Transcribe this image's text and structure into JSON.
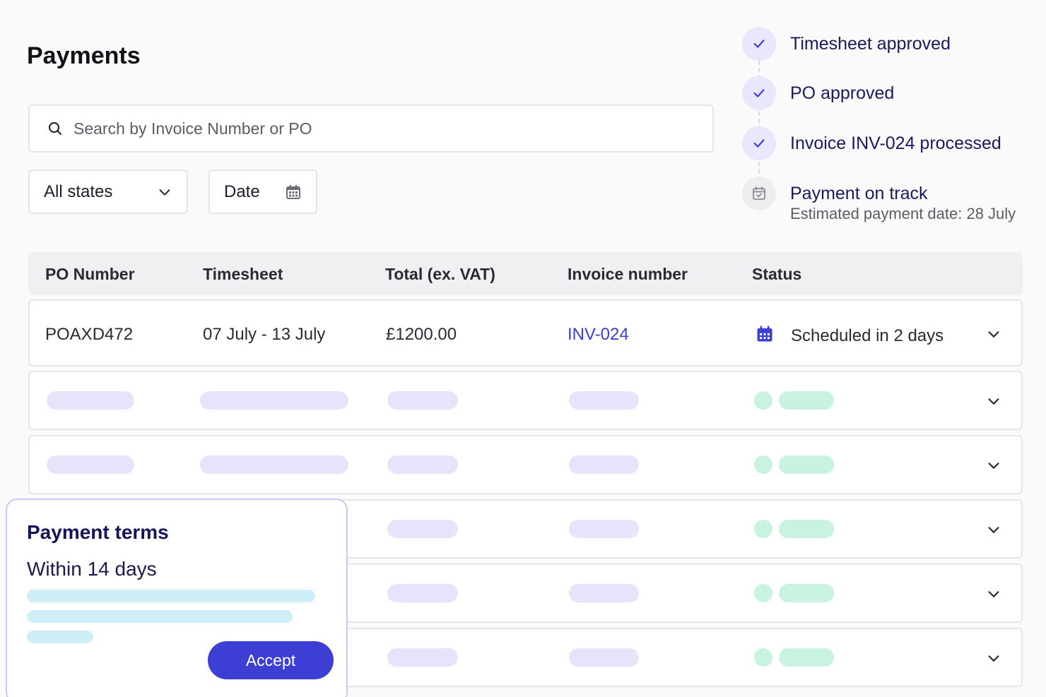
{
  "page": {
    "title": "Payments"
  },
  "search": {
    "placeholder": "Search by Invoice Number or PO",
    "icon": "search-icon"
  },
  "filters": {
    "state": {
      "selected": "All states",
      "icon": "chevron-down-icon"
    },
    "date": {
      "label": "Date",
      "icon": "calendar-icon"
    }
  },
  "timeline": {
    "steps": [
      {
        "label": "Timesheet approved",
        "status": "done",
        "icon": "check-icon"
      },
      {
        "label": "PO approved",
        "status": "done",
        "icon": "check-icon"
      },
      {
        "label": "Invoice INV-024 processed",
        "status": "done",
        "icon": "check-icon"
      },
      {
        "label": "Payment on track",
        "status": "pending",
        "icon": "calendar-check-icon",
        "sub": "Estimated payment date: 28 July"
      }
    ]
  },
  "table": {
    "columns": [
      "PO Number",
      "Timesheet",
      "Total (ex. VAT)",
      "Invoice number",
      "Status"
    ],
    "rows": [
      {
        "po": "POAXD472",
        "timesheet": "07 July - 13 July",
        "total": "£1200.00",
        "invoice": "INV-024",
        "status": "Scheduled in 2 days",
        "status_icon": "calendar-icon"
      }
    ],
    "placeholder_row_count": 5
  },
  "payment_terms": {
    "title": "Payment terms",
    "value": "Within 14 days",
    "accept_label": "Accept"
  },
  "colors": {
    "accent": "#3d3fd4",
    "link": "#3b3fd1",
    "skeleton_purple": "#e6e4fb",
    "skeleton_green": "#c8f3de",
    "skeleton_cyan": "#cfeff8",
    "heading_navy": "#14145a"
  }
}
